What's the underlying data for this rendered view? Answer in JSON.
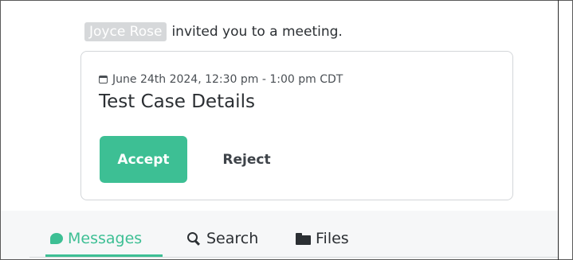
{
  "invite": {
    "sender": "Joyce Rose",
    "message": "invited you to a meeting."
  },
  "meeting": {
    "when": "June 24th 2024, 12:30 pm - 1:00 pm CDT",
    "title": "Test Case Details",
    "accept_label": "Accept",
    "reject_label": "Reject"
  },
  "tabs": [
    {
      "label": "Messages",
      "icon": "chat-bubble-icon",
      "active": true
    },
    {
      "label": "Search",
      "icon": "search-icon",
      "active": false
    },
    {
      "label": "Files",
      "icon": "folder-icon",
      "active": false
    }
  ],
  "colors": {
    "accent": "#3dbf94",
    "mention_bg": "#d6d8da",
    "text": "#2b2f33"
  }
}
